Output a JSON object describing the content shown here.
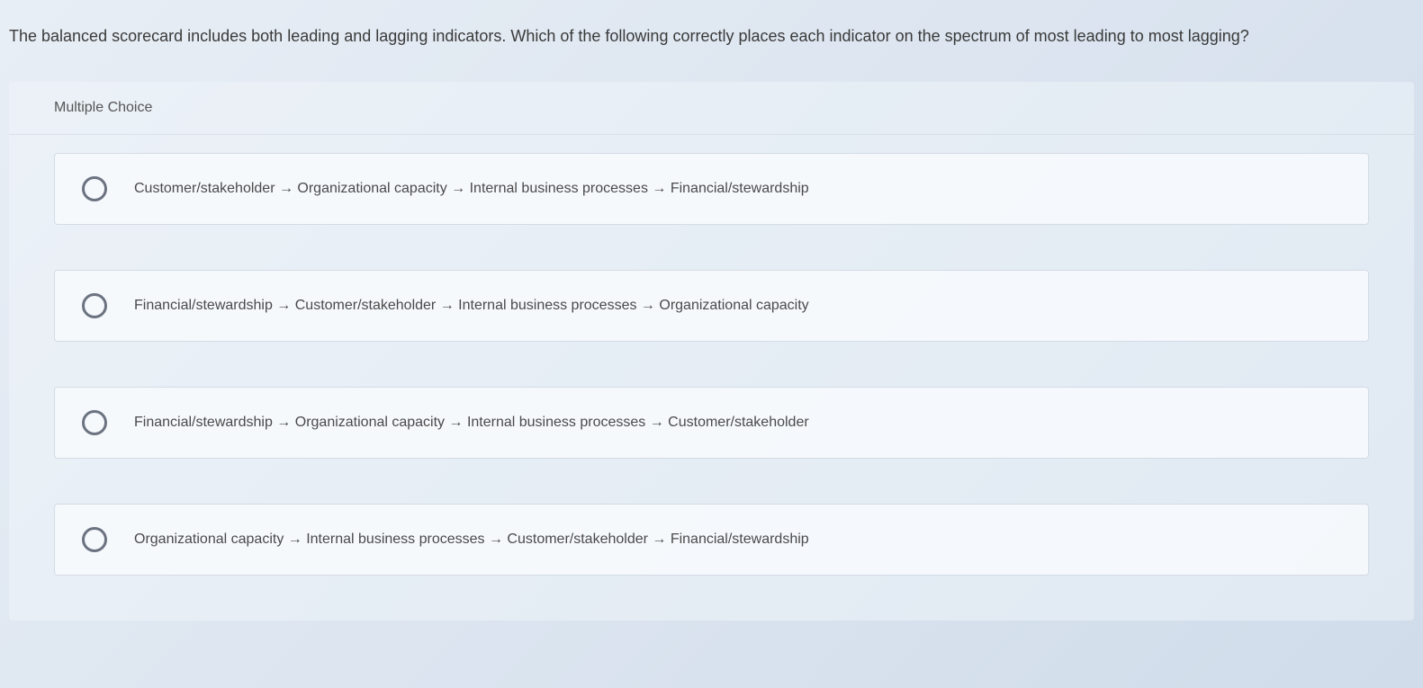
{
  "question": {
    "prompt": "The balanced scorecard includes both leading and lagging indicators. Which of the following correctly places each indicator on the spectrum of most leading to most lagging?"
  },
  "section": {
    "header": "Multiple Choice"
  },
  "options": [
    {
      "text": "Customer/stakeholder → Organizational capacity → Internal business processes → Financial/stewardship"
    },
    {
      "text": "Financial/stewardship → Customer/stakeholder → Internal business processes → Organizational capacity"
    },
    {
      "text": "Financial/stewardship → Organizational capacity → Internal business processes → Customer/stakeholder"
    },
    {
      "text": "Organizational capacity → Internal business processes → Customer/stakeholder → Financial/stewardship"
    }
  ]
}
